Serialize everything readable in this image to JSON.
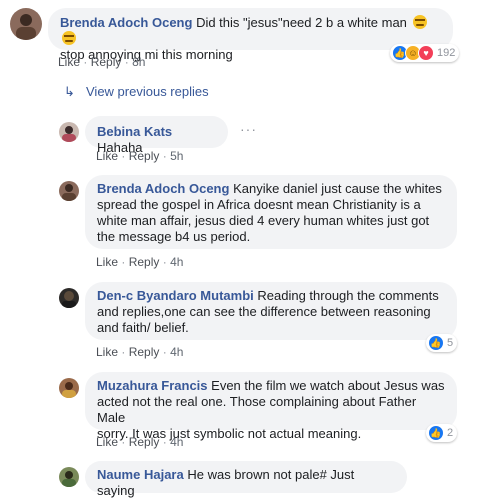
{
  "top_comment": {
    "author": "Brenda Adoch Oceng",
    "text_line1": "Did this \"jesus\"need 2 b a white man",
    "text_line2": "stop annoying mi this morning",
    "like": "Like",
    "reply": "Reply",
    "time": "8h",
    "reaction_count": "192",
    "reactions": [
      "like-icon",
      "haha-icon",
      "love-icon"
    ]
  },
  "view_previous": "View previous replies",
  "replies": [
    {
      "author": "Bebina Kats",
      "text": "Hahaha",
      "like": "Like",
      "reply": "Reply",
      "time": "5h"
    },
    {
      "author": "Brenda Adoch Oceng",
      "line1": "Kanyike daniel just cause the whites",
      "line2": "spread the gospel in Africa doesnt mean Christianity is a",
      "line3": "white man affair, jesus died 4 every human whites just got",
      "line4": "the message b4 us period.",
      "like": "Like",
      "reply": "Reply",
      "time": "4h"
    },
    {
      "author": "Den-c Byandaro Mutambi",
      "line1": "Reading through the comments",
      "line2": "and replies,one can see the difference between reasoning",
      "line3": "and faith/ belief.",
      "like": "Like",
      "reply": "Reply",
      "time": "4h",
      "reaction_count": "5"
    },
    {
      "author": "Muzahura Francis",
      "line1": "Even the film we watch about Jesus was",
      "line2": "acted not the real one. Those complaining about Father Male",
      "line3": "sorry. It was just symbolic not actual meaning.",
      "like": "Like",
      "reply": "Reply",
      "time": "4h",
      "reaction_count": "2"
    },
    {
      "author": "Naume Hajara",
      "text": "He was brown not pale# Just saying"
    }
  ],
  "colors": {
    "link": "#385898",
    "bubble": "#f2f3f5",
    "like_blue": "#1877f2"
  }
}
